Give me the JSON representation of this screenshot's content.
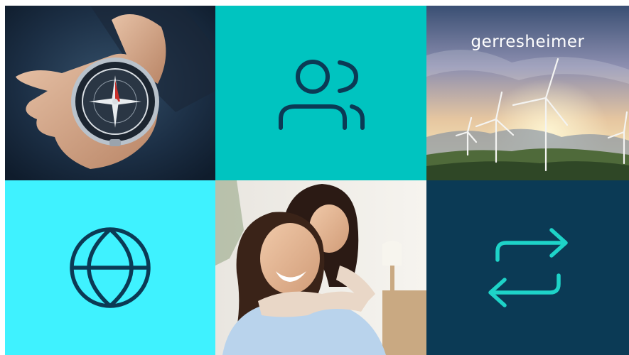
{
  "brand": {
    "logo_text": "gerresheimer"
  },
  "tiles": [
    {
      "kind": "photo",
      "subject": "compass-in-hand"
    },
    {
      "kind": "icon",
      "icon": "users-icon",
      "background": "#00C4C0",
      "stroke": "#0B3A55"
    },
    {
      "kind": "photo",
      "subject": "wind-turbines-landscape"
    },
    {
      "kind": "icon",
      "icon": "globe-icon",
      "background": "#3FF2FF",
      "stroke": "#0B3A55"
    },
    {
      "kind": "photo",
      "subject": "mother-and-daughter"
    },
    {
      "kind": "icon",
      "icon": "exchange-arrows-icon",
      "background": "#0B3A55",
      "stroke": "#1ED3C8"
    }
  ]
}
